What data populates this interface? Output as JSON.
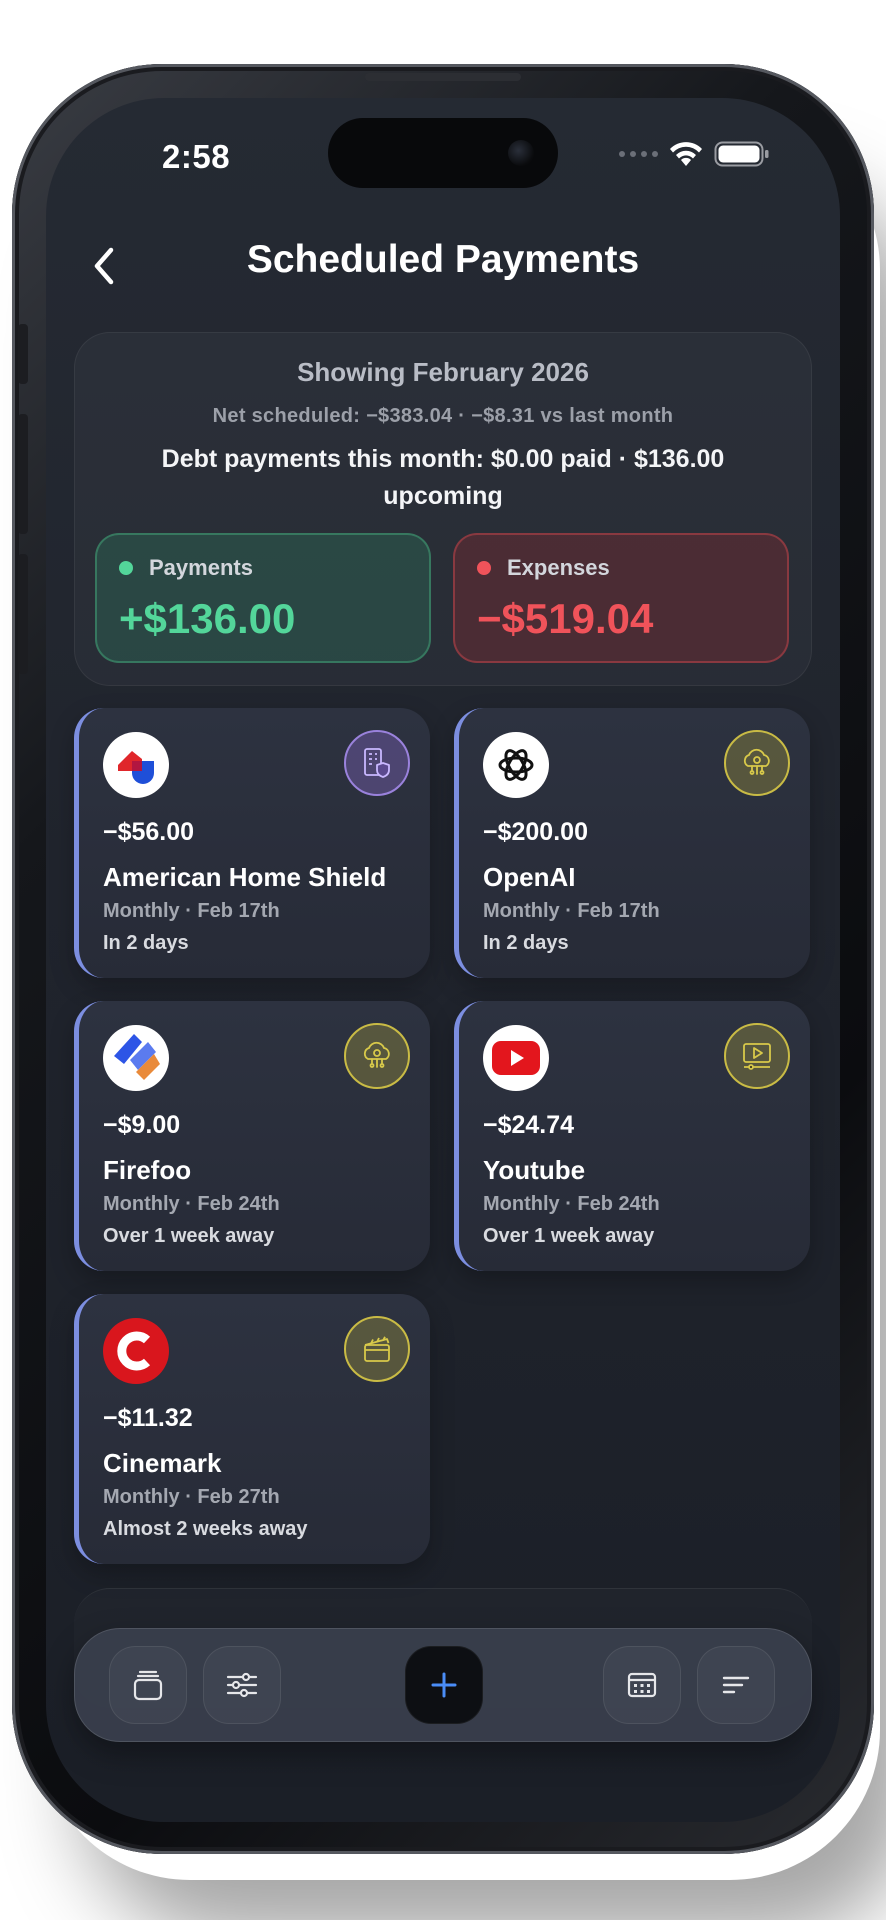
{
  "status_bar": {
    "time": "2:58"
  },
  "header": {
    "title": "Scheduled Payments"
  },
  "summary": {
    "month": "Showing February 2026",
    "net": "Net scheduled: −$383.04 · −$8.31 vs last month",
    "debt": "Debt payments this month: $0.00 paid · $136.00 upcoming",
    "payments": {
      "label": "Payments",
      "value": "+$136.00",
      "color": "#53d69a"
    },
    "expenses": {
      "label": "Expenses",
      "value": "−$519.04",
      "color": "#f0535a"
    }
  },
  "payments": [
    {
      "amount": "−$56.00",
      "name": "American Home Shield",
      "schedule": "Monthly · Feb 17th",
      "due": "In 2 days",
      "logo": "american-home-shield-logo",
      "category_icon": "building-shield-icon"
    },
    {
      "amount": "−$200.00",
      "name": "OpenAI",
      "schedule": "Monthly · Feb 17th",
      "due": "In 2 days",
      "logo": "openai-logo",
      "category_icon": "cloud-gear-icon"
    },
    {
      "amount": "−$9.00",
      "name": "Firefoo",
      "schedule": "Monthly · Feb 24th",
      "due": "Over 1 week away",
      "logo": "firefoo-logo",
      "category_icon": "cloud-gear-icon"
    },
    {
      "amount": "−$24.74",
      "name": "Youtube",
      "schedule": "Monthly · Feb 24th",
      "due": "Over 1 week away",
      "logo": "youtube-logo",
      "category_icon": "video-player-icon"
    },
    {
      "amount": "−$11.32",
      "name": "Cinemark",
      "schedule": "Monthly · Feb 27th",
      "due": "Almost 2 weeks away",
      "logo": "cinemark-logo",
      "category_icon": "clapperboard-icon"
    }
  ],
  "toolbar": {
    "icons": [
      "cards-stack-icon",
      "sliders-icon",
      "plus-icon",
      "calendar-icon",
      "sort-icon"
    ]
  }
}
